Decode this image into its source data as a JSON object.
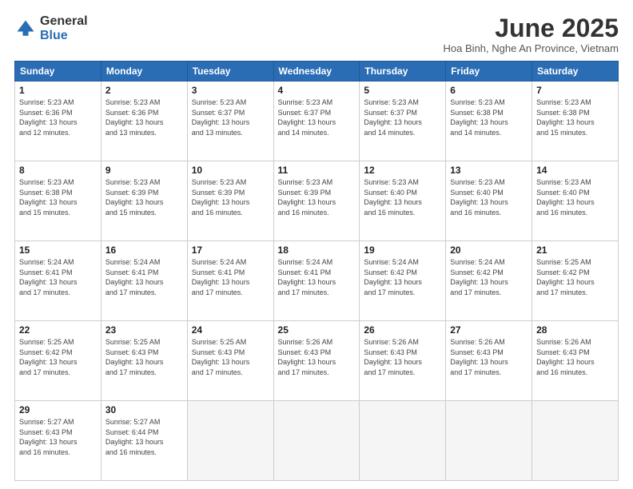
{
  "logo": {
    "general": "General",
    "blue": "Blue"
  },
  "title": "June 2025",
  "location": "Hoa Binh, Nghe An Province, Vietnam",
  "headers": [
    "Sunday",
    "Monday",
    "Tuesday",
    "Wednesday",
    "Thursday",
    "Friday",
    "Saturday"
  ],
  "weeks": [
    [
      {
        "day": "1",
        "sunrise": "5:23 AM",
        "sunset": "6:36 PM",
        "daylight": "13 hours and 12 minutes."
      },
      {
        "day": "2",
        "sunrise": "5:23 AM",
        "sunset": "6:36 PM",
        "daylight": "13 hours and 13 minutes."
      },
      {
        "day": "3",
        "sunrise": "5:23 AM",
        "sunset": "6:37 PM",
        "daylight": "13 hours and 13 minutes."
      },
      {
        "day": "4",
        "sunrise": "5:23 AM",
        "sunset": "6:37 PM",
        "daylight": "13 hours and 14 minutes."
      },
      {
        "day": "5",
        "sunrise": "5:23 AM",
        "sunset": "6:37 PM",
        "daylight": "13 hours and 14 minutes."
      },
      {
        "day": "6",
        "sunrise": "5:23 AM",
        "sunset": "6:38 PM",
        "daylight": "13 hours and 14 minutes."
      },
      {
        "day": "7",
        "sunrise": "5:23 AM",
        "sunset": "6:38 PM",
        "daylight": "13 hours and 15 minutes."
      }
    ],
    [
      {
        "day": "8",
        "sunrise": "5:23 AM",
        "sunset": "6:38 PM",
        "daylight": "13 hours and 15 minutes."
      },
      {
        "day": "9",
        "sunrise": "5:23 AM",
        "sunset": "6:39 PM",
        "daylight": "13 hours and 15 minutes."
      },
      {
        "day": "10",
        "sunrise": "5:23 AM",
        "sunset": "6:39 PM",
        "daylight": "13 hours and 16 minutes."
      },
      {
        "day": "11",
        "sunrise": "5:23 AM",
        "sunset": "6:39 PM",
        "daylight": "13 hours and 16 minutes."
      },
      {
        "day": "12",
        "sunrise": "5:23 AM",
        "sunset": "6:40 PM",
        "daylight": "13 hours and 16 minutes."
      },
      {
        "day": "13",
        "sunrise": "5:23 AM",
        "sunset": "6:40 PM",
        "daylight": "13 hours and 16 minutes."
      },
      {
        "day": "14",
        "sunrise": "5:23 AM",
        "sunset": "6:40 PM",
        "daylight": "13 hours and 16 minutes."
      }
    ],
    [
      {
        "day": "15",
        "sunrise": "5:24 AM",
        "sunset": "6:41 PM",
        "daylight": "13 hours and 17 minutes."
      },
      {
        "day": "16",
        "sunrise": "5:24 AM",
        "sunset": "6:41 PM",
        "daylight": "13 hours and 17 minutes."
      },
      {
        "day": "17",
        "sunrise": "5:24 AM",
        "sunset": "6:41 PM",
        "daylight": "13 hours and 17 minutes."
      },
      {
        "day": "18",
        "sunrise": "5:24 AM",
        "sunset": "6:41 PM",
        "daylight": "13 hours and 17 minutes."
      },
      {
        "day": "19",
        "sunrise": "5:24 AM",
        "sunset": "6:42 PM",
        "daylight": "13 hours and 17 minutes."
      },
      {
        "day": "20",
        "sunrise": "5:24 AM",
        "sunset": "6:42 PM",
        "daylight": "13 hours and 17 minutes."
      },
      {
        "day": "21",
        "sunrise": "5:25 AM",
        "sunset": "6:42 PM",
        "daylight": "13 hours and 17 minutes."
      }
    ],
    [
      {
        "day": "22",
        "sunrise": "5:25 AM",
        "sunset": "6:42 PM",
        "daylight": "13 hours and 17 minutes."
      },
      {
        "day": "23",
        "sunrise": "5:25 AM",
        "sunset": "6:43 PM",
        "daylight": "13 hours and 17 minutes."
      },
      {
        "day": "24",
        "sunrise": "5:25 AM",
        "sunset": "6:43 PM",
        "daylight": "13 hours and 17 minutes."
      },
      {
        "day": "25",
        "sunrise": "5:26 AM",
        "sunset": "6:43 PM",
        "daylight": "13 hours and 17 minutes."
      },
      {
        "day": "26",
        "sunrise": "5:26 AM",
        "sunset": "6:43 PM",
        "daylight": "13 hours and 17 minutes."
      },
      {
        "day": "27",
        "sunrise": "5:26 AM",
        "sunset": "6:43 PM",
        "daylight": "13 hours and 17 minutes."
      },
      {
        "day": "28",
        "sunrise": "5:26 AM",
        "sunset": "6:43 PM",
        "daylight": "13 hours and 16 minutes."
      }
    ],
    [
      {
        "day": "29",
        "sunrise": "5:27 AM",
        "sunset": "6:43 PM",
        "daylight": "13 hours and 16 minutes."
      },
      {
        "day": "30",
        "sunrise": "5:27 AM",
        "sunset": "6:44 PM",
        "daylight": "13 hours and 16 minutes."
      },
      null,
      null,
      null,
      null,
      null
    ]
  ]
}
